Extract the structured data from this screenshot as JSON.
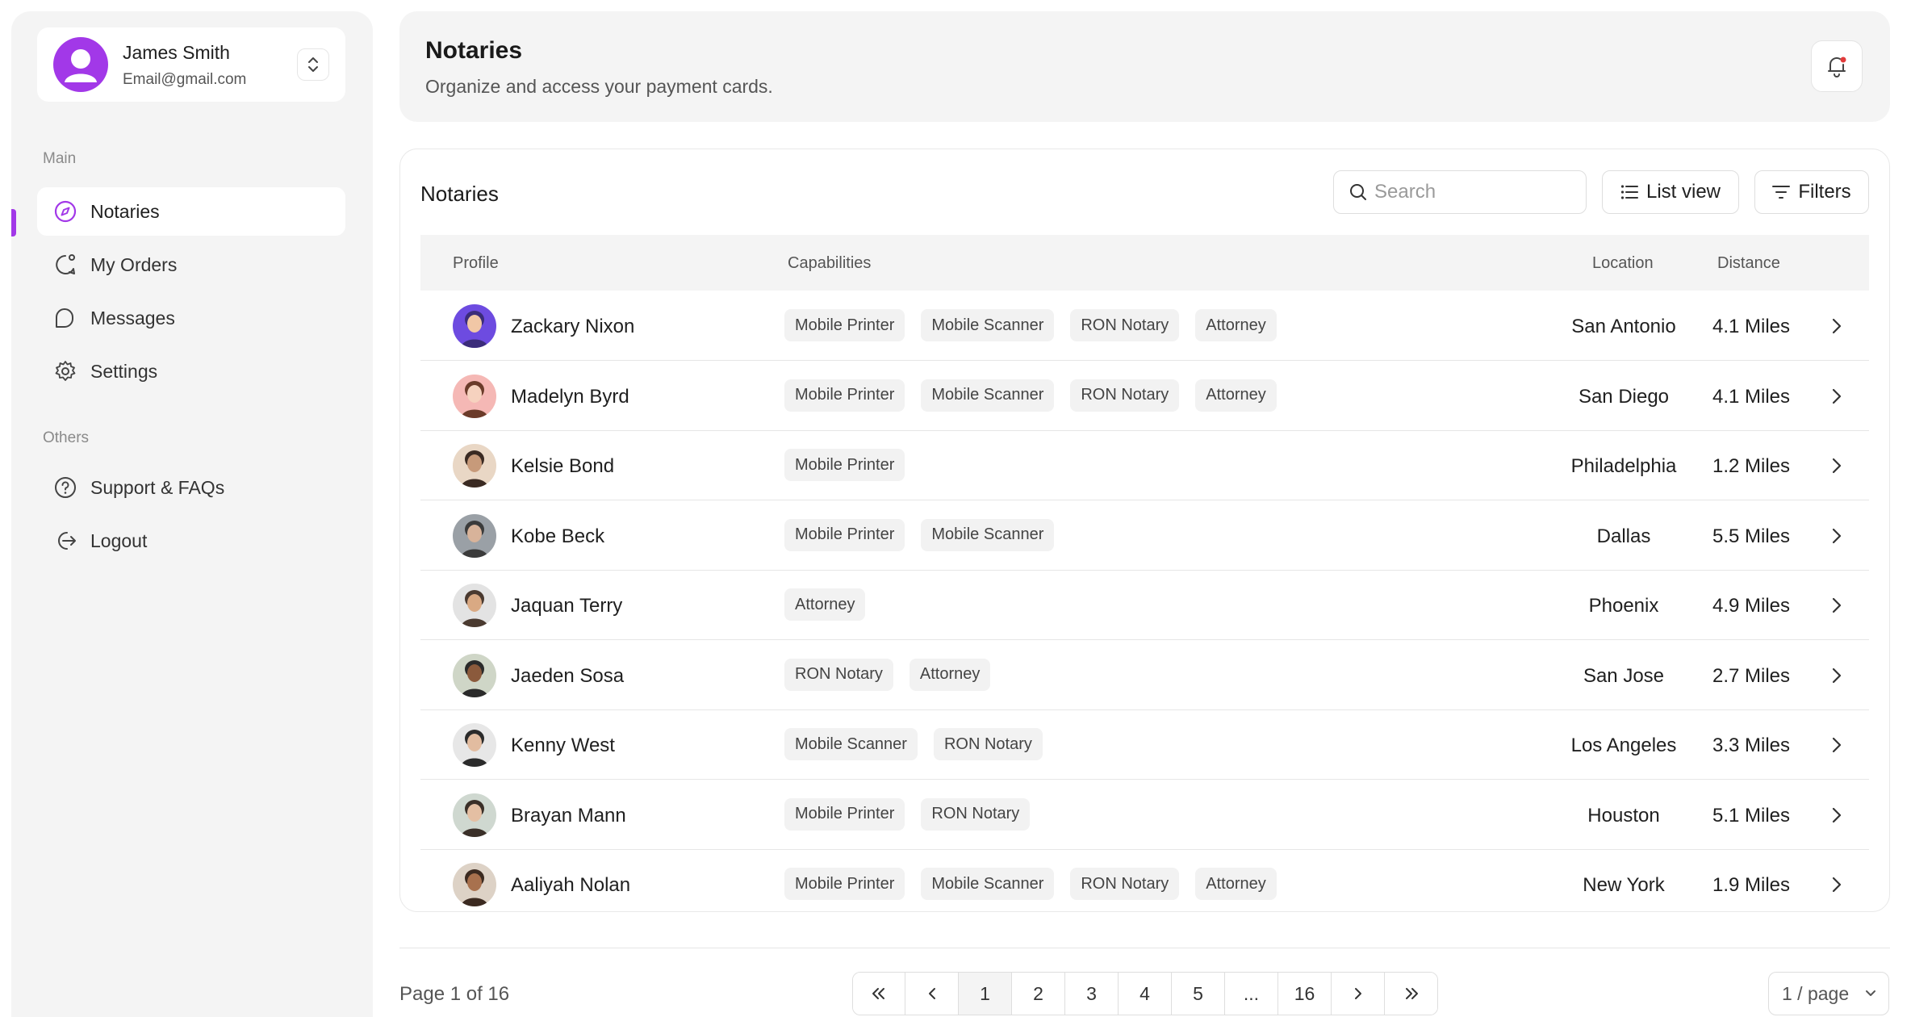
{
  "user": {
    "name": "James Smith",
    "email": "Email@gmail.com"
  },
  "sidebar": {
    "main_label": "Main",
    "others_label": "Others",
    "main_items": [
      {
        "label": "Notaries",
        "icon": "compass-icon",
        "active": true
      },
      {
        "label": "My Orders",
        "icon": "chat-bubble-icon",
        "active": false
      },
      {
        "label": "Messages",
        "icon": "message-icon",
        "active": false
      },
      {
        "label": "Settings",
        "icon": "gear-icon",
        "active": false
      }
    ],
    "other_items": [
      {
        "label": "Support & FAQs",
        "icon": "help-circle-icon"
      },
      {
        "label": "Logout",
        "icon": "logout-icon"
      }
    ]
  },
  "header": {
    "title": "Notaries",
    "subtitle": "Organize and access your payment cards."
  },
  "panel": {
    "title": "Notaries",
    "search_placeholder": "Search",
    "list_view_label": "List view",
    "filters_label": "Filters",
    "columns": {
      "profile": "Profile",
      "capabilities": "Capabilities",
      "location": "Location",
      "distance": "Distance"
    },
    "rows": [
      {
        "name": "Zackary Nixon",
        "tags": [
          "Mobile Printer",
          "Mobile Scanner",
          "RON Notary",
          "Attorney"
        ],
        "location": "San Antonio",
        "distance": "4.1 Miles"
      },
      {
        "name": "Madelyn Byrd",
        "tags": [
          "Mobile Printer",
          "Mobile Scanner",
          "RON Notary",
          "Attorney"
        ],
        "location": "San Diego",
        "distance": "4.1 Miles"
      },
      {
        "name": "Kelsie Bond",
        "tags": [
          "Mobile Printer"
        ],
        "location": "Philadelphia",
        "distance": "1.2 Miles"
      },
      {
        "name": "Kobe Beck",
        "tags": [
          "Mobile Printer",
          "Mobile Scanner"
        ],
        "location": "Dallas",
        "distance": "5.5 Miles"
      },
      {
        "name": "Jaquan Terry",
        "tags": [
          "Attorney"
        ],
        "location": "Phoenix",
        "distance": "4.9 Miles"
      },
      {
        "name": "Jaeden Sosa",
        "tags": [
          "RON Notary",
          "Attorney"
        ],
        "location": "San Jose",
        "distance": "2.7 Miles"
      },
      {
        "name": "Kenny West",
        "tags": [
          "Mobile Scanner",
          "RON Notary"
        ],
        "location": "Los Angeles",
        "distance": "3.3 Miles"
      },
      {
        "name": "Brayan Mann",
        "tags": [
          "Mobile Printer",
          "RON Notary"
        ],
        "location": "Houston",
        "distance": "5.1 Miles"
      },
      {
        "name": "Aaliyah Nolan",
        "tags": [
          "Mobile Printer",
          "Mobile Scanner",
          "RON Notary",
          "Attorney"
        ],
        "location": "New York",
        "distance": "1.9 Miles"
      }
    ]
  },
  "pagination": {
    "info": "Page 1 of 16",
    "pages": [
      "1",
      "2",
      "3",
      "4",
      "5",
      "...",
      "16"
    ],
    "current": "1",
    "first_icon": "double-chevron-left-icon",
    "prev_icon": "chevron-left-icon",
    "next_icon": "chevron-right-icon",
    "last_icon": "double-chevron-right-icon",
    "per_page": "1 / page"
  },
  "colors": {
    "accent": "#a238e8",
    "notification_dot": "#e23b3b"
  }
}
